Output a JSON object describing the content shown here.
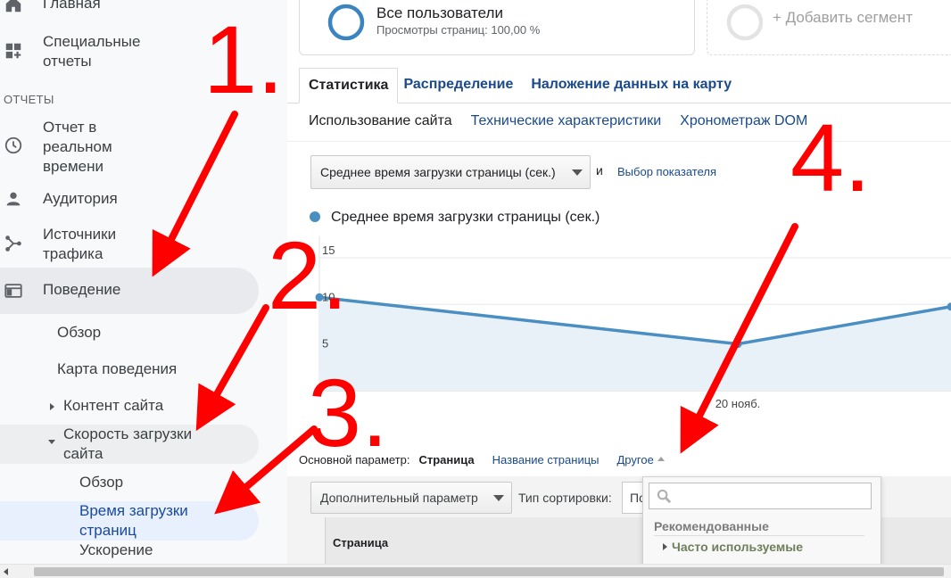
{
  "sidebar": {
    "items": [
      {
        "label": "Главная",
        "icon": "home-icon"
      },
      {
        "label": "Специальные отчеты",
        "icon": "custom-reports-icon"
      },
      {
        "label": "Отчет в реальном времени",
        "icon": "clock-icon"
      },
      {
        "label": "Аудитория",
        "icon": "person-icon"
      },
      {
        "label": "Источники трафика",
        "icon": "acquisition-icon"
      },
      {
        "label": "Поведение",
        "icon": "behavior-icon"
      }
    ],
    "section_label": "ОТЧЕТЫ",
    "behavior_sub": {
      "overview": "Обзор",
      "behavior_flow": "Карта поведения",
      "site_content": "Контент сайта",
      "site_speed": "Скорость загрузки сайта",
      "speed_overview": "Обзор",
      "page_timings": "Время загрузки страниц",
      "speed_suggestions": "Ускорение"
    }
  },
  "segments": {
    "all_users_title": "Все пользователи",
    "all_users_sub": "Просмотры страниц: 100,00 %",
    "add_segment": "+ Добавить сегмент"
  },
  "tabs": [
    "Статистика",
    "Распределение",
    "Наложение данных на карту"
  ],
  "subtabs": [
    "Использование сайта",
    "Технические характеристики",
    "Хронометраж DOM"
  ],
  "metric": {
    "selected": "Среднее время загрузки страницы (сек.)",
    "and": "и",
    "choose_metric": "Выбор показателя"
  },
  "chart_data": {
    "type": "line",
    "series": [
      {
        "name": "Среднее время загрузки страницы (сек.)",
        "values": [
          10,
          5,
          9
        ]
      }
    ],
    "x_labels": [
      "",
      "20 нояб.",
      ""
    ],
    "y_ticks": [
      "15",
      "10",
      "5"
    ],
    "ylim": [
      0,
      17
    ],
    "color": "#4a8ec2"
  },
  "dimension": {
    "label": "Основной параметр:",
    "selected": "Страница",
    "page_title": "Название страницы",
    "other": "Другое"
  },
  "secondary": {
    "select": "Дополнительный параметр",
    "sort_label": "Тип сортировки:",
    "sort_value": "По"
  },
  "table": {
    "col_page": "Страница"
  },
  "dropdown": {
    "search_placeholder": "",
    "group": "Рекомендованные",
    "item": "Часто используемые"
  },
  "annotations": [
    "1.",
    "2.",
    "3.",
    "4."
  ],
  "colors": {
    "accent": "#4a8ec2",
    "link": "#1a4a8c",
    "annotation": "#ff0000",
    "behavior_pill": "#e8eaed",
    "active_pill": "#e8f0fe"
  }
}
